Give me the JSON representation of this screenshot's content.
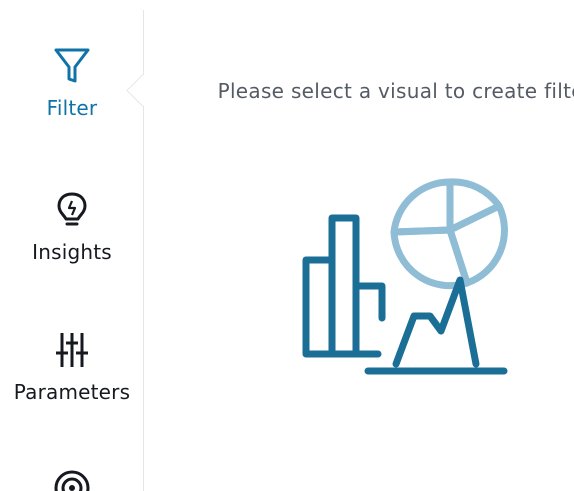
{
  "sidebar": {
    "items": [
      {
        "key": "filter",
        "label": "Filter",
        "icon": "filter-icon",
        "active": true
      },
      {
        "key": "insights",
        "label": "Insights",
        "icon": "lightbulb-icon",
        "active": false
      },
      {
        "key": "parameters",
        "label": "Parameters",
        "icon": "sliders-icon",
        "active": false
      },
      {
        "key": "more",
        "label": "",
        "icon": "target-icon",
        "active": false
      }
    ]
  },
  "main": {
    "empty_state_message": "Please select a visual to create filter",
    "illustration": "charts-illustration"
  },
  "colors": {
    "accent": "#0f73a8",
    "text": "#16191f",
    "muted_text": "#545b64",
    "illustration_dark": "#1b6e96",
    "illustration_light": "#8fbdd6"
  }
}
